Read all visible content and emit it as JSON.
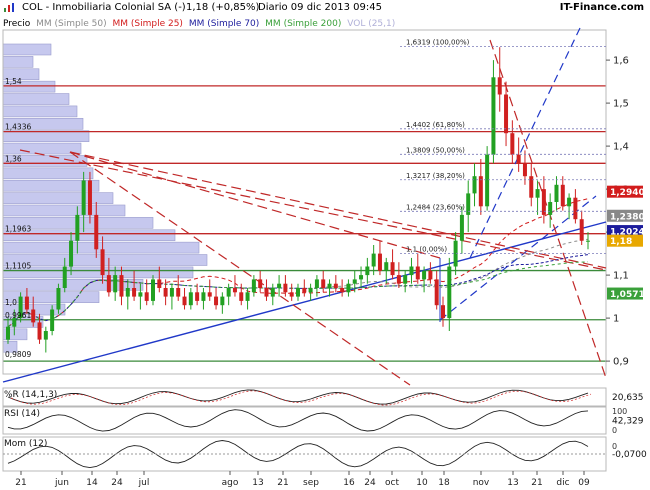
{
  "header": {
    "symbol": "COL - Inmobiliaria Colonial SA (-)",
    "price": "1,18 (+0,85%)",
    "period_date": "Diario  09 dic 2013 09:45",
    "brand": "IT-Finance.com"
  },
  "legend": {
    "prefix": "Precio",
    "items": [
      {
        "label": "MM (Simple 50)",
        "color": "#8c8c8c"
      },
      {
        "label": "MM (Simple 25)",
        "color": "#d21c1c"
      },
      {
        "label": "MM (Simple 70)",
        "color": "#1c1c9c"
      },
      {
        "label": "MM (Simple 200)",
        "color": "#3aa03a"
      },
      {
        "label": "VOL (25,1)",
        "color": "#b0b0d8"
      }
    ]
  },
  "colors": {
    "up": "#22a022",
    "down": "#d02020",
    "support": "#3a8a3a",
    "resistance": "#c02828",
    "trend_blue": "#2038c8",
    "volume_profile": "#c6c8ee"
  },
  "chart_data": {
    "type": "candlestick",
    "price_axis": {
      "range": [
        0.87,
        1.67
      ],
      "ticks": [
        "1,6",
        "1,5",
        "1,4",
        "1,3",
        "1,2",
        "1,1",
        "1",
        "0,9"
      ]
    },
    "x_labels": [
      "21",
      "jun",
      "14",
      "24",
      "jul",
      "ago",
      "13",
      "21",
      "sep",
      "16",
      "24",
      "oct",
      "10",
      "18",
      "nov",
      "13",
      "21",
      "dic",
      "09"
    ],
    "left_labels": [
      "1,54",
      "1,4336",
      "1,36",
      "1,1963",
      "1,1105",
      "1,0",
      "0,9961",
      "0,9809"
    ],
    "fibonacci": [
      {
        "label": "1,6319 (100,00%)",
        "value": 1.6319
      },
      {
        "label": "1,4402 (61,80%)",
        "value": 1.4402
      },
      {
        "label": "1,3809 (50,00%)",
        "value": 1.3809
      },
      {
        "label": "1,3217 (38,20%)",
        "value": 1.3217
      },
      {
        "label": "1,2484 (23,60%)",
        "value": 1.2484
      },
      {
        "label": "1,1 (0,00%)",
        "value": 1.15
      }
    ],
    "right_badges": [
      {
        "label": "1,2940",
        "value": 1.294,
        "color": "#d21c1c"
      },
      {
        "label": "1,2380",
        "value": 1.238,
        "color": "#888888"
      },
      {
        "label": "1,2024",
        "value": 1.2024,
        "color": "#1c1c9c"
      },
      {
        "label": "1,18",
        "value": 1.18,
        "color": "#e8a800"
      },
      {
        "label": "1,0571",
        "value": 1.0571,
        "color": "#3aa03a"
      }
    ],
    "horizontal_levels": [
      {
        "value": 1.54,
        "color": "#c02828"
      },
      {
        "value": 1.4336,
        "color": "#c02828"
      },
      {
        "value": 1.36,
        "color": "#c02828"
      },
      {
        "value": 1.1963,
        "color": "#c02828"
      },
      {
        "value": 1.1105,
        "color": "#3a8a3a"
      },
      {
        "value": 0.9961,
        "color": "#3a8a3a"
      },
      {
        "value": 0.9,
        "color": "#3a8a3a"
      }
    ],
    "candles": [
      [
        0.95,
        1.0,
        0.94,
        0.98
      ],
      [
        0.98,
        1.02,
        0.96,
        1.0
      ],
      [
        1.0,
        1.06,
        0.99,
        1.05
      ],
      [
        1.05,
        1.07,
        1.01,
        1.02
      ],
      [
        1.02,
        1.05,
        0.98,
        0.99
      ],
      [
        0.99,
        1.01,
        0.94,
        0.95
      ],
      [
        0.95,
        0.98,
        0.92,
        0.97
      ],
      [
        0.97,
        1.03,
        0.96,
        1.02
      ],
      [
        1.02,
        1.08,
        1.01,
        1.07
      ],
      [
        1.07,
        1.14,
        1.06,
        1.12
      ],
      [
        1.12,
        1.2,
        1.1,
        1.18
      ],
      [
        1.18,
        1.26,
        1.15,
        1.24
      ],
      [
        1.24,
        1.34,
        1.2,
        1.32
      ],
      [
        1.32,
        1.34,
        1.22,
        1.24
      ],
      [
        1.24,
        1.27,
        1.14,
        1.16
      ],
      [
        1.16,
        1.19,
        1.08,
        1.1
      ],
      [
        1.1,
        1.14,
        1.05,
        1.06
      ],
      [
        1.06,
        1.12,
        1.04,
        1.1
      ],
      [
        1.1,
        1.12,
        1.03,
        1.05
      ],
      [
        1.05,
        1.09,
        1.02,
        1.07
      ],
      [
        1.07,
        1.11,
        1.04,
        1.05
      ],
      [
        1.05,
        1.08,
        1.02,
        1.06
      ],
      [
        1.06,
        1.09,
        1.03,
        1.04
      ],
      [
        1.04,
        1.1,
        1.03,
        1.09
      ],
      [
        1.09,
        1.12,
        1.06,
        1.07
      ],
      [
        1.07,
        1.09,
        1.03,
        1.05
      ],
      [
        1.05,
        1.08,
        1.02,
        1.07
      ],
      [
        1.07,
        1.1,
        1.04,
        1.05
      ],
      [
        1.05,
        1.07,
        1.02,
        1.03
      ],
      [
        1.03,
        1.07,
        1.02,
        1.06
      ],
      [
        1.06,
        1.08,
        1.03,
        1.04
      ],
      [
        1.04,
        1.07,
        1.02,
        1.06
      ],
      [
        1.06,
        1.09,
        1.04,
        1.05
      ],
      [
        1.05,
        1.07,
        1.02,
        1.03
      ],
      [
        1.03,
        1.06,
        1.01,
        1.05
      ],
      [
        1.05,
        1.08,
        1.03,
        1.07
      ],
      [
        1.07,
        1.1,
        1.05,
        1.06
      ],
      [
        1.06,
        1.08,
        1.03,
        1.04
      ],
      [
        1.04,
        1.07,
        1.02,
        1.06
      ],
      [
        1.06,
        1.1,
        1.05,
        1.09
      ],
      [
        1.09,
        1.11,
        1.06,
        1.07
      ],
      [
        1.07,
        1.09,
        1.04,
        1.05
      ],
      [
        1.05,
        1.08,
        1.03,
        1.07
      ],
      [
        1.07,
        1.1,
        1.05,
        1.08
      ],
      [
        1.08,
        1.1,
        1.05,
        1.06
      ],
      [
        1.06,
        1.08,
        1.04,
        1.05
      ],
      [
        1.05,
        1.08,
        1.04,
        1.07
      ],
      [
        1.07,
        1.09,
        1.05,
        1.06
      ],
      [
        1.06,
        1.08,
        1.04,
        1.07
      ],
      [
        1.07,
        1.1,
        1.05,
        1.09
      ],
      [
        1.09,
        1.11,
        1.06,
        1.07
      ],
      [
        1.07,
        1.09,
        1.05,
        1.08
      ],
      [
        1.08,
        1.1,
        1.06,
        1.07
      ],
      [
        1.07,
        1.09,
        1.05,
        1.06
      ],
      [
        1.06,
        1.09,
        1.05,
        1.08
      ],
      [
        1.08,
        1.11,
        1.06,
        1.09
      ],
      [
        1.09,
        1.12,
        1.07,
        1.1
      ],
      [
        1.1,
        1.14,
        1.08,
        1.12
      ],
      [
        1.12,
        1.17,
        1.1,
        1.15
      ],
      [
        1.15,
        1.18,
        1.1,
        1.11
      ],
      [
        1.11,
        1.14,
        1.08,
        1.13
      ],
      [
        1.13,
        1.16,
        1.09,
        1.1
      ],
      [
        1.1,
        1.13,
        1.07,
        1.08
      ],
      [
        1.08,
        1.11,
        1.06,
        1.1
      ],
      [
        1.1,
        1.14,
        1.08,
        1.12
      ],
      [
        1.12,
        1.15,
        1.08,
        1.09
      ],
      [
        1.09,
        1.12,
        1.06,
        1.11
      ],
      [
        1.11,
        1.13,
        1.08,
        1.09
      ],
      [
        1.09,
        1.11,
        1.02,
        1.03
      ],
      [
        1.03,
        1.05,
        0.98,
        1.0
      ],
      [
        1.0,
        1.14,
        0.97,
        1.12
      ],
      [
        1.12,
        1.2,
        1.1,
        1.18
      ],
      [
        1.18,
        1.26,
        1.15,
        1.24
      ],
      [
        1.24,
        1.32,
        1.2,
        1.29
      ],
      [
        1.29,
        1.36,
        1.26,
        1.33
      ],
      [
        1.33,
        1.37,
        1.24,
        1.26
      ],
      [
        1.26,
        1.4,
        1.25,
        1.38
      ],
      [
        1.38,
        1.6,
        1.36,
        1.56
      ],
      [
        1.56,
        1.63,
        1.48,
        1.52
      ],
      [
        1.52,
        1.55,
        1.4,
        1.43
      ],
      [
        1.43,
        1.46,
        1.36,
        1.38
      ],
      [
        1.38,
        1.42,
        1.34,
        1.36
      ],
      [
        1.36,
        1.39,
        1.31,
        1.33
      ],
      [
        1.33,
        1.36,
        1.26,
        1.28
      ],
      [
        1.28,
        1.32,
        1.24,
        1.3
      ],
      [
        1.3,
        1.33,
        1.22,
        1.24
      ],
      [
        1.24,
        1.29,
        1.21,
        1.27
      ],
      [
        1.27,
        1.33,
        1.25,
        1.31
      ],
      [
        1.31,
        1.33,
        1.25,
        1.26
      ],
      [
        1.26,
        1.29,
        1.23,
        1.28
      ],
      [
        1.28,
        1.3,
        1.22,
        1.23
      ],
      [
        1.23,
        1.25,
        1.17,
        1.18
      ],
      [
        1.18,
        1.2,
        1.16,
        1.18
      ]
    ],
    "indicators": [
      {
        "name": "%R",
        "label": "%R (14,1,3)",
        "value_label": "20,635",
        "range": [
          0,
          100
        ]
      },
      {
        "name": "RSI",
        "label": "RSI (14)",
        "value_label": "42,329",
        "ticks": [
          "100",
          "0"
        ],
        "range": [
          0,
          100
        ]
      },
      {
        "name": "Mom",
        "label": "Mom (12)",
        "value_label": "-0,0700",
        "ticks": [
          "0"
        ],
        "range": [
          -0.2,
          0.2
        ]
      }
    ]
  }
}
